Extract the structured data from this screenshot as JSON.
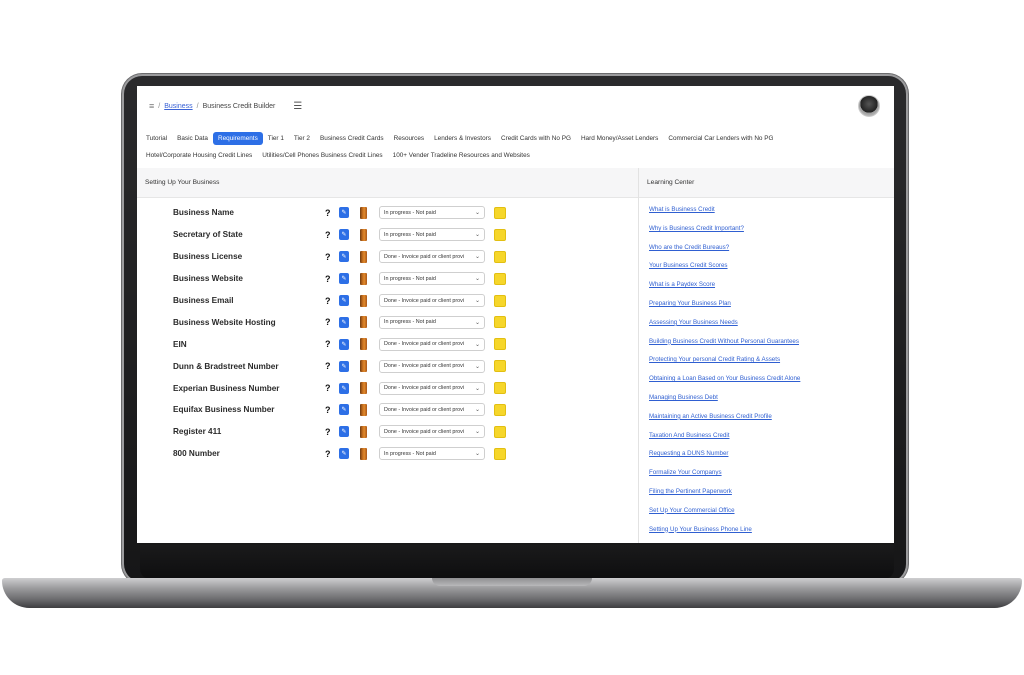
{
  "breadcrumb": {
    "home_icon": "list-icon",
    "business": "Business",
    "current": "Business Credit Builder"
  },
  "tabs_row1": [
    "Tutorial",
    "Basic Data",
    "Requirements",
    "Tier 1",
    "Tier 2",
    "Business Credit Cards",
    "Resources",
    "Lenders & Investors",
    "Credit Cards with No PG",
    "Hard Money/Asset Lenders",
    "Commercial Car Lenders with No PG"
  ],
  "tabs_row2": [
    "Hotel/Corporate Housing Credit Lines",
    "Utilities/Cell Phones Business Credit Lines",
    "100+ Vender Tradeline Resources and Websites"
  ],
  "active_tab": "Requirements",
  "left_panel": {
    "title": "Setting Up Your Business"
  },
  "right_panel": {
    "title": "Learning Center"
  },
  "requirements": [
    {
      "name": "Business Name",
      "status": "In progress - Not paid"
    },
    {
      "name": "Secretary of State",
      "status": "In progress - Not paid"
    },
    {
      "name": "Business License",
      "status": "Done - Invoice paid or client provi"
    },
    {
      "name": "Business Website",
      "status": "In progress - Not paid"
    },
    {
      "name": "Business Email",
      "status": "Done - Invoice paid or client provi"
    },
    {
      "name": "Business Website Hosting",
      "status": "In progress - Not paid"
    },
    {
      "name": "EIN",
      "status": "Done - Invoice paid or client provi"
    },
    {
      "name": "Dunn & Bradstreet Number",
      "status": "Done - Invoice paid or client provi"
    },
    {
      "name": "Experian Business Number",
      "status": "Done - Invoice paid or client provi"
    },
    {
      "name": "Equifax Business Number",
      "status": "Done - Invoice paid or client provi"
    },
    {
      "name": "Register 411",
      "status": "Done - Invoice paid or client provi"
    },
    {
      "name": "800 Number",
      "status": "In progress - Not paid"
    }
  ],
  "help_label": "?",
  "learning_center": [
    "What is Business Credit",
    "Why is Business Credit Important?",
    "Who are the Credit Bureaus?",
    "Your Business Credit Scores",
    "What is a Paydex Score",
    "Preparing Your Business Plan",
    "Assessing Your Business Needs",
    "Building Business Credit Without Personal Guarantees",
    "Protecting Your personal Credit Rating & Assets",
    "Obtaining a Loan Based on Your Business Credit Alone",
    "Managing Business Debt",
    "Maintaining an Active Business Credit Profile",
    "Taxation And Business Credit",
    "Requesting a DUNS Number",
    "Formalize Your Companys",
    "Filing the Pertinent Paperwork",
    "Set Up Your Commercial Office",
    "Setting Up Your Business Phone Line"
  ],
  "colors": {
    "accent": "#2d6fe6",
    "link": "#2f5fd1",
    "note": "#f6d62a"
  }
}
